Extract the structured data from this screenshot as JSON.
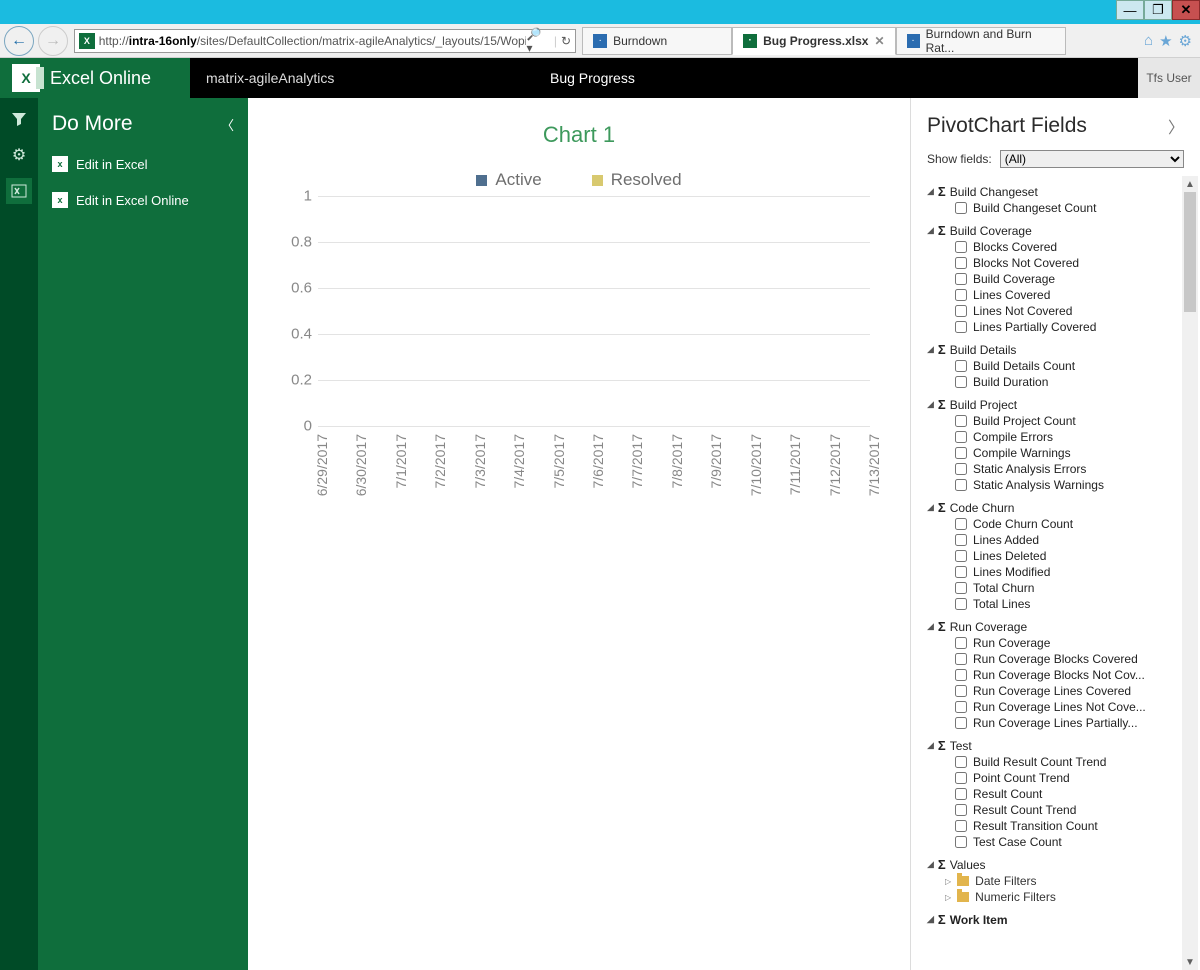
{
  "window": {
    "url_prefix": "http://",
    "url_bold": "intra-16only",
    "url_rest": "/sites/DefaultCollection/matrix-agileAnalytics/_layouts/15/WopiF"
  },
  "tabs": [
    {
      "label": "Burndown",
      "active": false,
      "color": "#2b6cb0"
    },
    {
      "label": "Bug Progress.xlsx",
      "active": true,
      "color": "#0f6e3c"
    },
    {
      "label": "Burndown and Burn Rat...",
      "active": false,
      "color": "#2b6cb0"
    }
  ],
  "app": {
    "brand": "Excel Online",
    "breadcrumb": "matrix-agileAnalytics",
    "doc": "Bug Progress",
    "user": "Tfs User"
  },
  "sidebar": {
    "title": "Do More",
    "items": [
      {
        "label": "Edit in Excel"
      },
      {
        "label": "Edit in Excel Online"
      }
    ]
  },
  "chart_data": {
    "type": "line",
    "title": "Chart 1",
    "series": [
      {
        "name": "Active",
        "values": []
      },
      {
        "name": "Resolved",
        "values": []
      }
    ],
    "categories": [
      "6/29/2017",
      "6/30/2017",
      "7/1/2017",
      "7/2/2017",
      "7/3/2017",
      "7/4/2017",
      "7/5/2017",
      "7/6/2017",
      "7/7/2017",
      "7/8/2017",
      "7/9/2017",
      "7/10/2017",
      "7/11/2017",
      "7/12/2017",
      "7/13/2017"
    ],
    "ylim": [
      0,
      1
    ],
    "yticks": [
      0,
      0.2,
      0.4,
      0.6,
      0.8,
      1
    ],
    "xlabel": "",
    "ylabel": ""
  },
  "panel": {
    "title": "PivotChart Fields",
    "show_label": "Show fields:",
    "show_value": "(All)",
    "groups": [
      {
        "name": "Build Changeset",
        "fields": [
          "Build Changeset Count"
        ]
      },
      {
        "name": "Build Coverage",
        "fields": [
          "Blocks Covered",
          "Blocks Not Covered",
          "Build Coverage",
          "Lines Covered",
          "Lines Not Covered",
          "Lines Partially Covered"
        ]
      },
      {
        "name": "Build Details",
        "fields": [
          "Build Details Count",
          "Build Duration"
        ]
      },
      {
        "name": "Build Project",
        "fields": [
          "Build Project Count",
          "Compile Errors",
          "Compile Warnings",
          "Static Analysis Errors",
          "Static Analysis Warnings"
        ]
      },
      {
        "name": "Code Churn",
        "fields": [
          "Code Churn Count",
          "Lines Added",
          "Lines Deleted",
          "Lines Modified",
          "Total Churn",
          "Total Lines"
        ]
      },
      {
        "name": "Run Coverage",
        "fields": [
          "Run Coverage",
          "Run Coverage Blocks Covered",
          "Run Coverage Blocks Not Cov...",
          "Run Coverage Lines Covered",
          "Run Coverage Lines Not Cove...",
          "Run Coverage Lines Partially..."
        ]
      },
      {
        "name": "Test",
        "fields": [
          "Build Result Count Trend",
          "Point Count Trend",
          "Result Count",
          "Result Count Trend",
          "Result Transition Count",
          "Test Case Count"
        ]
      }
    ],
    "values_label": "Values",
    "value_folders": [
      "Date Filters",
      "Numeric Filters"
    ],
    "workitem_label": "Work Item"
  }
}
